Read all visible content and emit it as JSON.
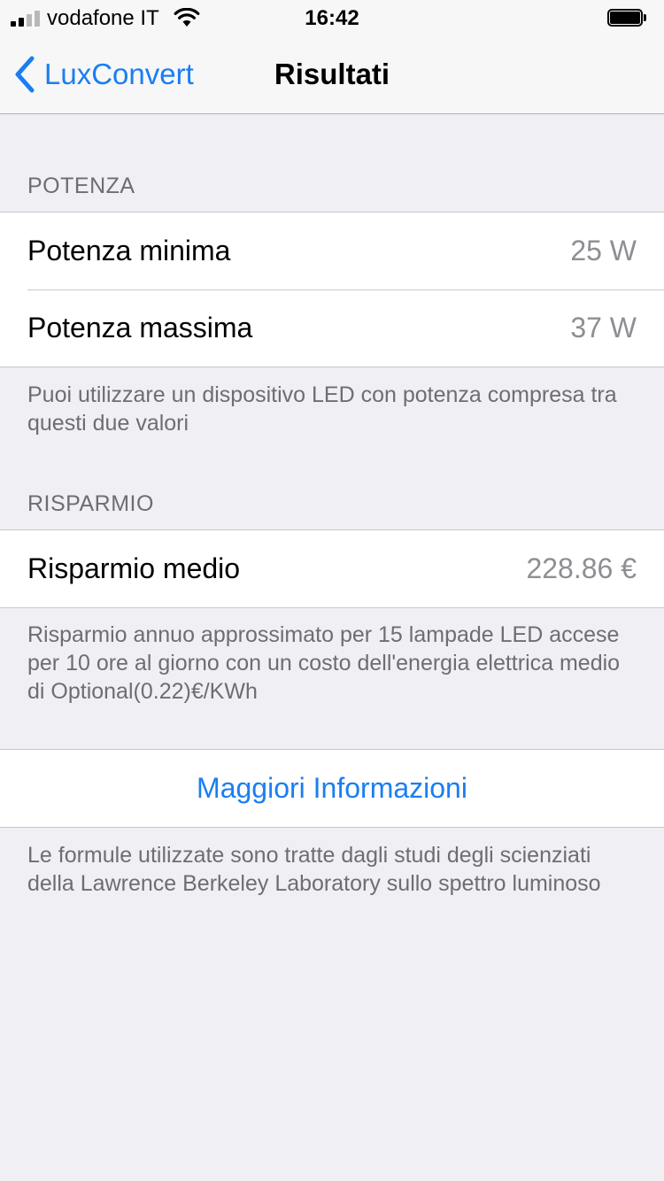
{
  "status_bar": {
    "carrier": "vodafone IT",
    "time": "16:42",
    "signal_bars_active": 2,
    "signal_bars_total": 4,
    "battery_level": 1.0
  },
  "nav": {
    "back_label": "LuxConvert",
    "title": "Risultati",
    "back_icon": "chevron-left-icon"
  },
  "potenza": {
    "header": "POTENZA",
    "rows": [
      {
        "label": "Potenza minima",
        "value": "25 W"
      },
      {
        "label": "Potenza massima",
        "value": "37 W"
      }
    ],
    "footer": "Puoi utilizzare un dispositivo LED con potenza compresa tra questi due valori"
  },
  "risparmio": {
    "header": "RISPARMIO",
    "rows": [
      {
        "label": "Risparmio medio",
        "value": "228.86 €"
      }
    ],
    "footer": "Risparmio annuo approssimato per 15 lampade LED accese per 10 ore al giorno con un costo dell'energia elettrica medio di Optional(0.22)€/KWh"
  },
  "info": {
    "button_label": "Maggiori Informazioni",
    "footer": "Le formule utilizzate sono tratte dagli studi degli scienziati della Lawrence Berkeley Laboratory sullo spettro luminoso"
  },
  "colors": {
    "accent": "#1a7ef2",
    "background": "#efeff4",
    "secondary_text": "#6d6d72",
    "value_text": "#8e8e93"
  }
}
